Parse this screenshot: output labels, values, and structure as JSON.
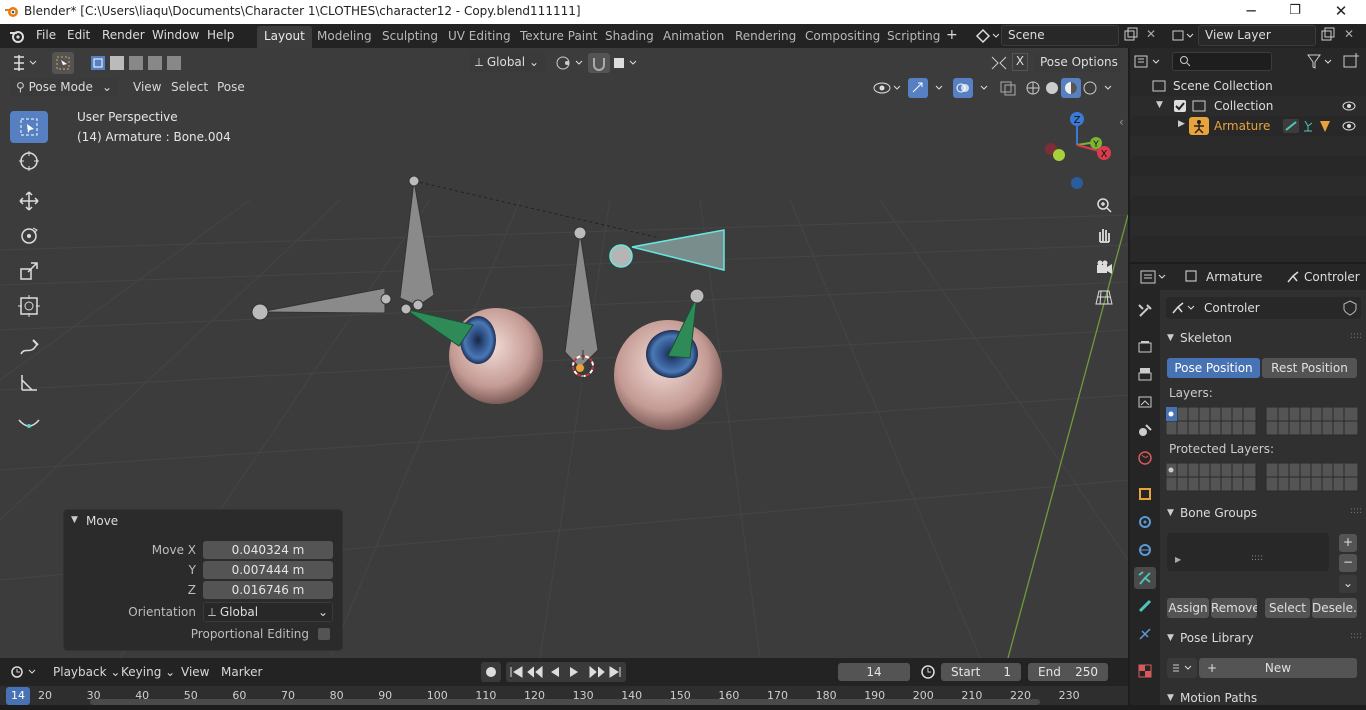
{
  "window": {
    "title": "Blender* [C:\\Users\\liaqu\\Documents\\Character 1\\CLOTHES\\character12 - Copy.blend111111]",
    "minimize": "─",
    "maximize": "❐",
    "close": "✕"
  },
  "menu": {
    "file": "File",
    "edit": "Edit",
    "render": "Render",
    "window": "Window",
    "help": "Help"
  },
  "workspaces": [
    "Layout",
    "Modeling",
    "Sculpting",
    "UV Editing",
    "Texture Paint",
    "Shading",
    "Animation",
    "Rendering",
    "Compositing",
    "Scripting"
  ],
  "add_workspace": "+",
  "scene": {
    "name": "Scene",
    "view_layer": "View Layer"
  },
  "header": {
    "orientation": "Global",
    "pose_options": "Pose Options",
    "x_mirror": "X"
  },
  "viewport_header": {
    "mode": "Pose Mode",
    "view": "View",
    "select": "Select",
    "pose": "Pose"
  },
  "viewport": {
    "perspective": "User Perspective",
    "object_info": "(14) Armature : Bone.004"
  },
  "gizmo": {
    "z": "Z",
    "y": "Y",
    "x": "X"
  },
  "move_panel": {
    "title": "Move",
    "move_x_label": "Move X",
    "move_x": "0.040324 m",
    "y_label": "Y",
    "y": "0.007444 m",
    "z_label": "Z",
    "z": "0.016746 m",
    "orientation_label": "Orientation",
    "orientation": "Global",
    "proportional_label": "Proportional Editing"
  },
  "outliner": {
    "scene_collection": "Scene Collection",
    "collection": "Collection",
    "armature": "Armature"
  },
  "properties": {
    "breadcrumb_object": "Armature",
    "breadcrumb_data": "Controler",
    "data_name": "Controler",
    "skeleton": "Skeleton",
    "pose_position": "Pose Position",
    "rest_position": "Rest Position",
    "layers": "Layers:",
    "protected_layers": "Protected Layers:",
    "bone_groups": "Bone Groups",
    "assign": "Assign",
    "remove": "Remove",
    "select": "Select",
    "deselect": "Desele...",
    "pose_library": "Pose Library",
    "new": "New",
    "motion_paths": "Motion Paths",
    "plus": "+",
    "minus": "−"
  },
  "timeline": {
    "playback": "Playback",
    "keying": "Keying",
    "view": "View",
    "marker": "Marker",
    "current_frame": "14",
    "start_label": "Start",
    "start": "1",
    "end_label": "End",
    "end": "250",
    "ticks": [
      "20",
      "30",
      "40",
      "50",
      "60",
      "70",
      "80",
      "90",
      "100",
      "110",
      "120",
      "130",
      "140",
      "150",
      "160",
      "170",
      "180",
      "190",
      "200",
      "210",
      "220",
      "230"
    ],
    "frame_indicator": "14"
  },
  "colors": {
    "accent": "#5680c2",
    "active_object": "#e8a33c",
    "bone_selected": "#66e8e0",
    "bone_green": "#2e8b57"
  }
}
